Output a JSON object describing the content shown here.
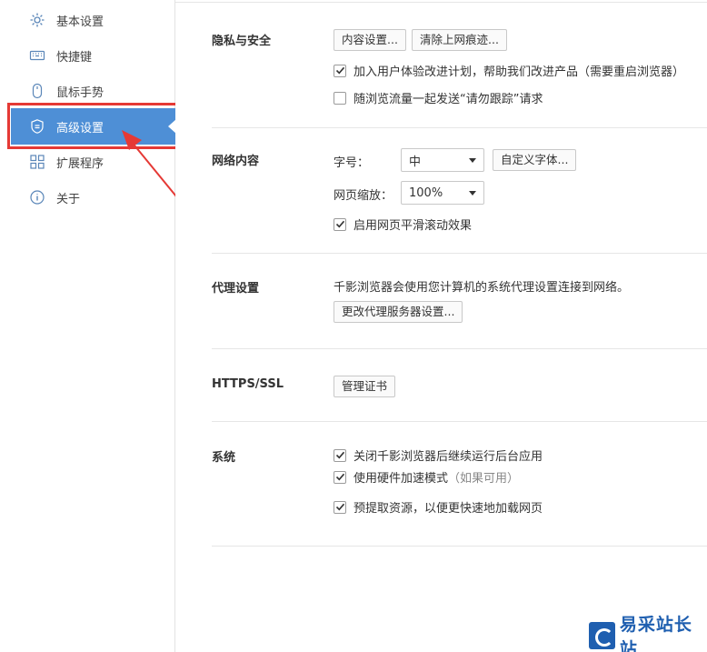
{
  "sidebar": {
    "items": [
      {
        "label": "基本设置",
        "icon": "gear-icon"
      },
      {
        "label": "快捷键",
        "icon": "keyboard-icon"
      },
      {
        "label": "鼠标手势",
        "icon": "mouse-icon"
      },
      {
        "label": "高级设置",
        "icon": "shield-icon",
        "active": true
      },
      {
        "label": "扩展程序",
        "icon": "extensions-grid-icon"
      },
      {
        "label": "关于",
        "icon": "info-icon"
      }
    ],
    "active_color": "#4e8fd6",
    "highlight_color": "#e53935"
  },
  "privacy": {
    "title": "隐私与安全",
    "content_settings_btn": "内容设置...",
    "clear_history_btn": "清除上网痕迹...",
    "ux_program_label": "加入用户体验改进计划，帮助我们改进产品（需要重启浏览器）",
    "ux_program_checked": true,
    "dnt_label": "随浏览流量一起发送“请勿跟踪”请求",
    "dnt_checked": false
  },
  "web_content": {
    "title": "网络内容",
    "font_size_label": "字号：",
    "font_size_value": "中",
    "custom_fonts_btn": "自定义字体...",
    "zoom_label": "网页缩放：",
    "zoom_value": "100%",
    "smooth_scroll_label": "启用网页平滑滚动效果",
    "smooth_scroll_checked": true
  },
  "proxy": {
    "title": "代理设置",
    "description": "千影浏览器会使用您计算机的系统代理设置连接到网络。",
    "change_proxy_btn": "更改代理服务器设置..."
  },
  "https": {
    "title": "HTTPS/SSL",
    "manage_certs_btn": "管理证书"
  },
  "system": {
    "title": "系统",
    "background_apps_label": "关闭千影浏览器后继续运行后台应用",
    "background_apps_checked": true,
    "hw_accel_label": "使用硬件加速模式",
    "hw_accel_suffix": "（如果可用）",
    "hw_accel_checked": true,
    "prefetch_label": "预提取资源，以便更快速地加载网页",
    "prefetch_checked": true
  },
  "watermark": {
    "text": "易采站长站"
  }
}
